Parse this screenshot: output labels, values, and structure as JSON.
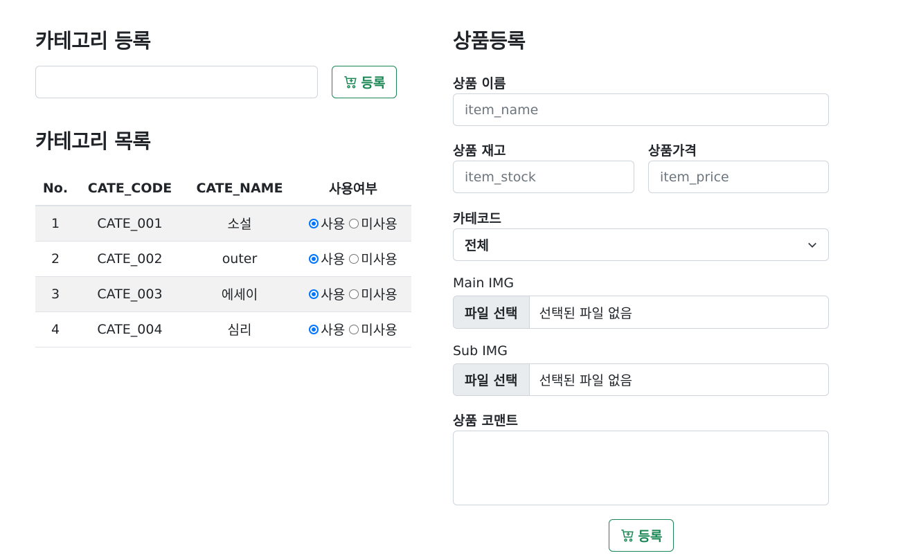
{
  "category_register": {
    "heading": "카테고리 등록",
    "input_value": "",
    "button_label": "등록"
  },
  "category_list": {
    "heading": "카테고리 목록",
    "columns": [
      "No.",
      "CATE_CODE",
      "CATE_NAME",
      "사용여부"
    ],
    "rows": [
      {
        "no": "1",
        "code": "CATE_001",
        "name": "소설",
        "use": "사용",
        "unused": "미사용",
        "selected": "사용"
      },
      {
        "no": "2",
        "code": "CATE_002",
        "name": "outer",
        "use": "사용",
        "unused": "미사용",
        "selected": "사용"
      },
      {
        "no": "3",
        "code": "CATE_003",
        "name": "에세이",
        "use": "사용",
        "unused": "미사용",
        "selected": "사용"
      },
      {
        "no": "4",
        "code": "CATE_004",
        "name": "심리",
        "use": "사용",
        "unused": "미사용",
        "selected": "사용"
      }
    ]
  },
  "product_register": {
    "heading": "상품등록",
    "name_label": "상품 이름",
    "name_placeholder": "item_name",
    "stock_label": "상품 재고",
    "stock_placeholder": "item_stock",
    "price_label": "상품가격",
    "price_placeholder": "item_price",
    "category_label": "카테코드",
    "category_selected": "전체",
    "main_img_label": "Main IMG",
    "sub_img_label": "Sub IMG",
    "file_button": "파일 선택",
    "file_status": "선택된 파일 없음",
    "comment_label": "상품 코맨트",
    "comment_value": "",
    "submit_label": "등록"
  },
  "colors": {
    "accent_green": "#198754",
    "radio_blue": "#0075ff",
    "stripe": "#f2f2f2"
  },
  "icons": {
    "register_button_icon": "cart-plus-icon",
    "select_icon": "chevron-down-icon"
  }
}
